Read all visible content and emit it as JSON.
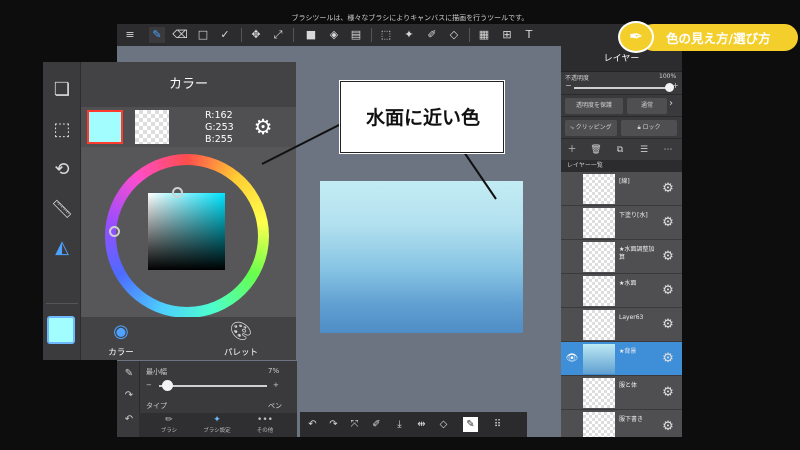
{
  "top_hint": "ブラシツールは、様々なブラシによりキャンバスに描画を行うツールです。",
  "brand": {
    "text": "色の見え方/選び方"
  },
  "toolbar": {
    "icons": [
      "menu-icon",
      "brush-icon",
      "eraser-icon",
      "select-rect-icon",
      "check-pen-icon",
      "move-icon",
      "transform-icon",
      "fill-icon",
      "bucket-icon",
      "gradient-icon",
      "lasso-icon",
      "magic-wand-icon",
      "pen-select-icon",
      "select-eraser-icon",
      "frame-icon",
      "text-edit-icon",
      "text-icon"
    ]
  },
  "color_panel": {
    "title": "カラー",
    "rgb": {
      "r": "R:162",
      "g": "G:253",
      "b": "B:255"
    },
    "main_color": "#a2fdff",
    "tabs": {
      "color": "カラー",
      "palette": "パレット"
    }
  },
  "callout": {
    "text": "水面に近い色"
  },
  "left_bottom": {
    "min_width_label": "最小幅",
    "min_width_value": "7%",
    "min_width_fraction": 0.07,
    "type_label": "タイプ",
    "type_value": "ペン",
    "tabs": {
      "brush": "ブラシ",
      "brush_settings": "ブラシ設定",
      "other": "その他"
    }
  },
  "layer_panel": {
    "title": "レイヤー",
    "opacity_label": "不透明度",
    "opacity_value": "100%",
    "opacity_fraction": 1.0,
    "protect_label": "透明度を保護",
    "blend_mode": "通常",
    "clipping_label": "クリッピング",
    "lock_label": "ロック",
    "list_title": "レイヤー一覧",
    "layers": [
      {
        "name": "[線]",
        "selected": false
      },
      {
        "name": "下塗り[水]",
        "selected": false
      },
      {
        "name": "★水面調整加算",
        "selected": false
      },
      {
        "name": "★水面",
        "selected": false
      },
      {
        "name": "Layer63",
        "selected": false
      },
      {
        "name": "★背景",
        "selected": true
      },
      {
        "name": "服と体",
        "selected": false
      },
      {
        "name": "服下書き",
        "selected": false
      }
    ]
  },
  "colors": {
    "accent": "#4da3ff",
    "selected_layer": "#3f8fd8",
    "brand": "#f4cf2c",
    "swatch_border": "#ff3b2f"
  }
}
